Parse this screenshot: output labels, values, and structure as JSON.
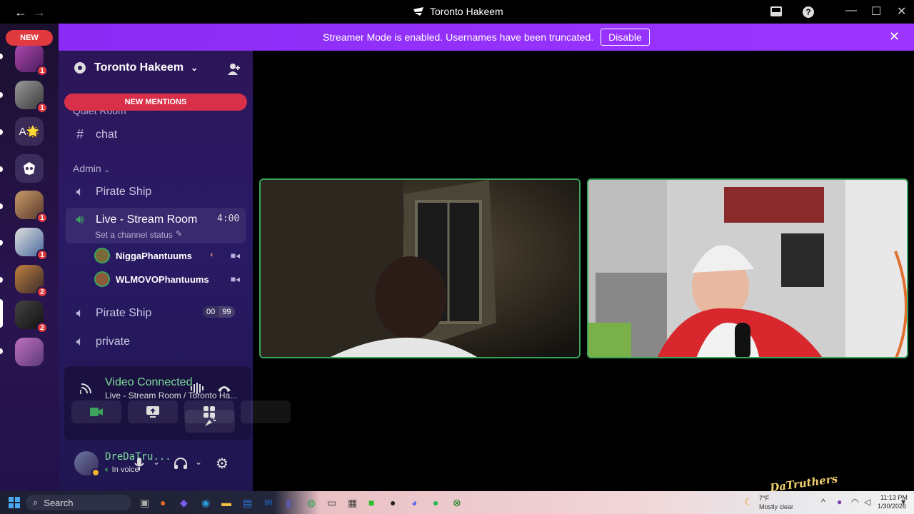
{
  "window": {
    "title": "Toronto Hakeem",
    "back_glyph": "←",
    "forward_glyph": "→",
    "minimize_glyph": "—",
    "maximize_glyph": "☐",
    "close_glyph": "✕"
  },
  "rail": {
    "new_label": "NEW",
    "servers": [
      {
        "name": "server-1",
        "badge": "1",
        "color": "#8a3d8f"
      },
      {
        "name": "server-2",
        "badge": "1",
        "color": "#6e6a72"
      },
      {
        "name": "server-3",
        "badge": "",
        "color": "#3a2a58",
        "text": "A🌟"
      },
      {
        "name": "server-4",
        "badge": "",
        "color": "#3b2c5e"
      },
      {
        "name": "server-5",
        "badge": "1",
        "color": "#7a5a3a"
      },
      {
        "name": "server-6",
        "badge": "1",
        "color": "#4a3a3a"
      },
      {
        "name": "server-7",
        "badge": "2",
        "color": "#5a4a40"
      },
      {
        "name": "server-8",
        "badge": "2",
        "color": "#2a2a2a"
      },
      {
        "name": "server-9",
        "badge": "",
        "color": "#9a5aa0"
      }
    ]
  },
  "banner": {
    "message": "Streamer Mode is enabled. Usernames have been truncated.",
    "disable_label": "Disable"
  },
  "sidebar": {
    "server_name": "Toronto Hakeem",
    "new_mentions": "NEW MENTIONS",
    "quiet_room": "Quiet Room",
    "chat": "chat",
    "admin_category": "Admin",
    "pirate_ship_1": "Pirate Ship",
    "live_room": "Live - Stream Room",
    "live_timer": "4:00",
    "live_status": "Set a channel status",
    "users": [
      {
        "name": "NiggaPhantuums"
      },
      {
        "name": "WLMOVOPhantuums"
      }
    ],
    "pirate_ship_2": "Pirate Ship",
    "pirate_ship_2_count_a": "00",
    "pirate_ship_2_count_b": "99",
    "private": "private"
  },
  "voice": {
    "status": "Video Connected",
    "location": "Live - Stream Room / Toronto Ha..."
  },
  "user_panel": {
    "username": "DreDaTru...",
    "status": "In voice"
  },
  "watermark": "DaTruthers",
  "taskbar": {
    "search": "Search",
    "weather_temp": "7°F",
    "weather_desc": "Mostly clear",
    "time": "11:13 PM",
    "date": "1/30/2026"
  },
  "colors": {
    "accent": "#9c35ff",
    "voice_green": "#3ba55d",
    "mention_red": "#d9304a"
  }
}
